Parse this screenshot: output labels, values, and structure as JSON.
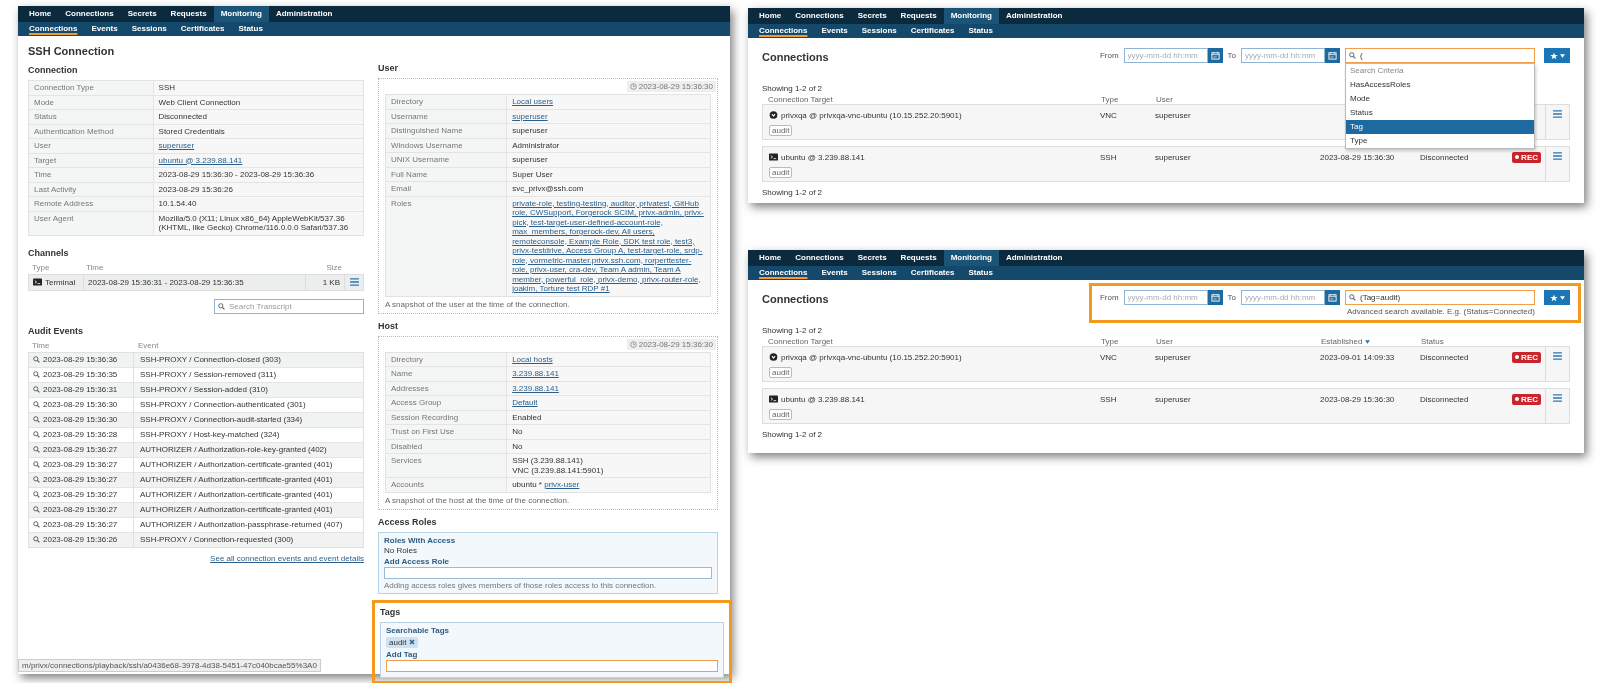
{
  "detail_view": {
    "nav": [
      {
        "label": "Home",
        "selected": false
      },
      {
        "label": "Connections",
        "selected": false
      },
      {
        "label": "Secrets",
        "selected": false
      },
      {
        "label": "Requests",
        "selected": false
      },
      {
        "label": "Monitoring",
        "selected": true
      },
      {
        "label": "Administration",
        "selected": false
      }
    ],
    "subnav": [
      {
        "label": "Connections",
        "selected": true
      },
      {
        "label": "Events",
        "selected": false
      },
      {
        "label": "Sessions",
        "selected": false
      },
      {
        "label": "Certificates",
        "selected": false
      },
      {
        "label": "Status",
        "selected": false
      }
    ],
    "title": "SSH Connection",
    "connection": {
      "heading": "Connection",
      "rows": [
        {
          "label": "Connection Type",
          "lines": [
            [
              {
                "text": "SSH",
                "link": false
              }
            ]
          ]
        },
        {
          "label": "Mode",
          "lines": [
            [
              {
                "text": "Web Client Connection",
                "link": false
              }
            ]
          ]
        },
        {
          "label": "Status",
          "lines": [
            [
              {
                "text": "Disconnected",
                "link": false
              }
            ]
          ]
        },
        {
          "label": "Authentication Method",
          "lines": [
            [
              {
                "text": "Stored Credentials",
                "link": false
              }
            ]
          ]
        },
        {
          "label": "User",
          "lines": [
            [
              {
                "text": "superuser",
                "link": true
              }
            ]
          ]
        },
        {
          "label": "Target",
          "lines": [
            [
              {
                "text": "ubuntu @ 3.239.88.141",
                "link": true
              }
            ]
          ]
        },
        {
          "label": "Time",
          "lines": [
            [
              {
                "text": "2023-08-29 15:36:30 - 2023-08-29 15:36:36",
                "link": false
              }
            ]
          ]
        },
        {
          "label": "Last Activity",
          "lines": [
            [
              {
                "text": "2023-08-29 15:36:26",
                "link": false
              }
            ]
          ]
        },
        {
          "label": "Remote Address",
          "lines": [
            [
              {
                "text": "10.1.54.40",
                "link": false
              }
            ]
          ]
        },
        {
          "label": "User Agent",
          "lines": [
            [
              {
                "text": "Mozilla/5.0 (X11; Linux x86_64) AppleWebKit/537.36 (KHTML, like Gecko) Chrome/116.0.0.0 Safari/537.36",
                "link": false
              }
            ]
          ]
        }
      ]
    },
    "channels": {
      "heading": "Channels",
      "columns": [
        "Type",
        "Time",
        "Size"
      ],
      "rows": [
        {
          "type": "Terminal",
          "time": "2023-08-29 15:36:31 - 2023-08-29 15:36:35",
          "size": "1 KB"
        }
      ],
      "search_placeholder": "Search Transcript"
    },
    "audit_events": {
      "heading": "Audit Events",
      "columns": [
        "Time",
        "Event"
      ],
      "rows": [
        {
          "time": "2023-08-29 15:36:36",
          "event": "SSH-PROXY / Connection-closed (303)"
        },
        {
          "time": "2023-08-29 15:36:35",
          "event": "SSH-PROXY / Session-removed (311)"
        },
        {
          "time": "2023-08-29 15:36:31",
          "event": "SSH-PROXY / Session-added (310)"
        },
        {
          "time": "2023-08-29 15:36:30",
          "event": "SSH-PROXY / Connection-authenticated (301)"
        },
        {
          "time": "2023-08-29 15:36:30",
          "event": "SSH-PROXY / Connection-audit-started (334)"
        },
        {
          "time": "2023-08-29 15:36:28",
          "event": "SSH-PROXY / Host-key-matched (324)"
        },
        {
          "time": "2023-08-29 15:36:27",
          "event": "AUTHORIZER / Authorization-role-key-granted (402)"
        },
        {
          "time": "2023-08-29 15:36:27",
          "event": "AUTHORIZER / Authorization-certificate-granted (401)"
        },
        {
          "time": "2023-08-29 15:36:27",
          "event": "AUTHORIZER / Authorization-certificate-granted (401)"
        },
        {
          "time": "2023-08-29 15:36:27",
          "event": "AUTHORIZER / Authorization-certificate-granted (401)"
        },
        {
          "time": "2023-08-29 15:36:27",
          "event": "AUTHORIZER / Authorization-certificate-granted (401)"
        },
        {
          "time": "2023-08-29 15:36:27",
          "event": "AUTHORIZER / Authorization-passphrase-returned (407)"
        },
        {
          "time": "2023-08-29 15:36:26",
          "event": "SSH-PROXY / Connection-requested (300)"
        }
      ],
      "link": "See all connection events and event details"
    },
    "user": {
      "heading": "User",
      "timestamp": "2023-08-29 15:36:30",
      "rows": [
        {
          "label": "Directory",
          "lines": [
            [
              {
                "text": "Local users",
                "link": true
              }
            ]
          ]
        },
        {
          "label": "Username",
          "lines": [
            [
              {
                "text": "superuser",
                "link": true
              }
            ]
          ]
        },
        {
          "label": "Distinguished Name",
          "lines": [
            [
              {
                "text": "superuser",
                "link": false
              }
            ]
          ]
        },
        {
          "label": "Windows Username",
          "lines": [
            [
              {
                "text": "Administrator",
                "link": false
              }
            ]
          ]
        },
        {
          "label": "UNIX Username",
          "lines": [
            [
              {
                "text": "superuser",
                "link": false
              }
            ]
          ]
        },
        {
          "label": "Full Name",
          "lines": [
            [
              {
                "text": "Super User",
                "link": false
              }
            ]
          ]
        },
        {
          "label": "Email",
          "lines": [
            [
              {
                "text": "svc_privx@ssh.com",
                "link": false
              }
            ]
          ]
        },
        {
          "label": "Roles",
          "lines": [
            [
              {
                "text": "private-role, testing-testing, auditor, privatest, GitHub role, CWSupport, Forgerock SCIM, privx-admin, privx-pick, test-target-user-defined-account-role, max_members, forgerock-dev, All users, remoteconsole, Example Role, SDK test role, test3, privx-testdrive, Access Group A, test-target-role, srdp-role, vormetric-master.privx.ssh.com, rorperttester-role, privx-user, cra-dev, Team A admin, Team A member, powerful_role, privx-demo, privx-router-role, joakim, Torture test RDP #1",
                "link": true
              }
            ]
          ]
        }
      ],
      "caption": "A snapshot of the user at the time of the connection."
    },
    "host": {
      "heading": "Host",
      "timestamp": "2023-08-29 15:36:30",
      "rows": [
        {
          "label": "Directory",
          "lines": [
            [
              {
                "text": "Local hosts",
                "link": true
              }
            ]
          ]
        },
        {
          "label": "Name",
          "lines": [
            [
              {
                "text": "3.239.88.141",
                "link": true
              }
            ]
          ]
        },
        {
          "label": "Addresses",
          "lines": [
            [
              {
                "text": "3.239.88.141",
                "link": true
              }
            ]
          ]
        },
        {
          "label": "Access Group",
          "lines": [
            [
              {
                "text": "Default",
                "link": true
              }
            ]
          ]
        },
        {
          "label": "Session Recording",
          "lines": [
            [
              {
                "text": "Enabled",
                "link": false
              }
            ]
          ]
        },
        {
          "label": "Trust on First Use",
          "lines": [
            [
              {
                "text": "No",
                "link": false
              }
            ]
          ]
        },
        {
          "label": "Disabled",
          "lines": [
            [
              {
                "text": "No",
                "link": false
              }
            ]
          ]
        },
        {
          "label": "Services",
          "lines": [
            [
              {
                "text": "SSH (3.239.88.141)",
                "link": false
              }
            ],
            [
              {
                "text": "VNC (3.239.88.141:5901)",
                "link": false
              }
            ]
          ]
        },
        {
          "label": "Accounts",
          "lines": [
            [
              {
                "text": "ubuntu *",
                "link": false
              },
              {
                "text": "privx-user",
                "link": true
              }
            ]
          ]
        }
      ],
      "caption": "A snapshot of the host at the time of the connection."
    },
    "access_roles": {
      "heading": "Access Roles",
      "label": "Roles With Access",
      "value": "No Roles",
      "field_label": "Add Access Role",
      "focused": false,
      "hint": "Adding access roles gives members of those roles access to this connection."
    },
    "tags": {
      "heading": "Tags",
      "highlighted": true,
      "label": "Searchable Tags",
      "chips": [
        "audit"
      ],
      "field_label": "Add Tag",
      "focused": true
    },
    "status_url": "m/privx/connections/playback/ssh/a0436e68-3978-4d38-5451-47c040bcae55%3A0"
  },
  "criteria_view": {
    "nav": [
      {
        "label": "Home",
        "selected": false
      },
      {
        "label": "Connections",
        "selected": false
      },
      {
        "label": "Secrets",
        "selected": false
      },
      {
        "label": "Requests",
        "selected": false
      },
      {
        "label": "Monitoring",
        "selected": true
      },
      {
        "label": "Administration",
        "selected": false
      }
    ],
    "subnav": [
      {
        "label": "Connections",
        "selected": true
      },
      {
        "label": "Events",
        "selected": false
      },
      {
        "label": "Sessions",
        "selected": false
      },
      {
        "label": "Certificates",
        "selected": false
      },
      {
        "label": "Status",
        "selected": false
      }
    ],
    "title": "Connections",
    "filters": {
      "highlighted": false,
      "from_label": "From",
      "from_placeholder": "yyyy-mm-dd hh:mm",
      "to_label": "To",
      "to_placeholder": "yyyy-mm-dd hh:mm",
      "search_value": "(",
      "focused": true,
      "dropdown": [
        {
          "kind": "header",
          "label": "Search Criteria"
        },
        {
          "kind": "option",
          "label": "HasAccessRoles",
          "selected": false
        },
        {
          "kind": "option",
          "label": "Mode",
          "selected": false
        },
        {
          "kind": "option",
          "label": "Status",
          "selected": false
        },
        {
          "kind": "option",
          "label": "Tag",
          "selected": true
        },
        {
          "kind": "option",
          "label": "Type",
          "selected": false
        }
      ]
    },
    "showing_top": "Showing 1-2 of 2",
    "columns": [
      {
        "label": "Connection Target",
        "sorted": false
      },
      {
        "label": "Type",
        "sorted": false
      },
      {
        "label": "User",
        "sorted": false
      }
    ],
    "rows": [
      {
        "kind": "vnc",
        "target": "privxqa @ privxqa-vnc-ubuntu (10.15.252.20:5901)",
        "type": "VNC",
        "user": "superuser",
        "tags": [
          "audit"
        ]
      },
      {
        "kind": "ssh",
        "target": "ubuntu @ 3.239.88.141",
        "type": "SSH",
        "user": "superuser",
        "established": "2023-08-29 15:36:30",
        "status": "Disconnected",
        "rec": "REC",
        "tags": [
          "audit"
        ]
      }
    ],
    "showing_bottom": "Showing 1-2 of 2"
  },
  "filtered_view": {
    "nav": [
      {
        "label": "Home",
        "selected": false
      },
      {
        "label": "Connections",
        "selected": false
      },
      {
        "label": "Secrets",
        "selected": false
      },
      {
        "label": "Requests",
        "selected": false
      },
      {
        "label": "Monitoring",
        "selected": true
      },
      {
        "label": "Administration",
        "selected": false
      }
    ],
    "subnav": [
      {
        "label": "Connections",
        "selected": true
      },
      {
        "label": "Events",
        "selected": false
      },
      {
        "label": "Sessions",
        "selected": false
      },
      {
        "label": "Certificates",
        "selected": false
      },
      {
        "label": "Status",
        "selected": false
      }
    ],
    "title": "Connections",
    "filters": {
      "highlighted": true,
      "from_label": "From",
      "from_placeholder": "yyyy-mm-dd hh:mm",
      "to_label": "To",
      "to_placeholder": "yyyy-mm-dd hh:mm",
      "search_value": "(Tag=audit)",
      "focused": true,
      "hint": "Advanced search available. E.g. (Status=Connected)"
    },
    "showing_top": "Showing 1-2 of 2",
    "columns": [
      {
        "label": "Connection Target",
        "sorted": false
      },
      {
        "label": "Type",
        "sorted": false
      },
      {
        "label": "User",
        "sorted": false
      },
      {
        "label": "Established",
        "sorted": true
      },
      {
        "label": "Status",
        "sorted": false
      }
    ],
    "rows": [
      {
        "kind": "vnc",
        "target": "privxqa @ privxqa-vnc-ubuntu (10.15.252.20:5901)",
        "type": "VNC",
        "user": "superuser",
        "established": "2023-09-01 14:09:33",
        "status": "Disconnected",
        "rec": "REC",
        "tags": [
          "audit"
        ]
      },
      {
        "kind": "ssh",
        "target": "ubuntu @ 3.239.88.141",
        "type": "SSH",
        "user": "superuser",
        "established": "2023-08-29 15:36:30",
        "status": "Disconnected",
        "rec": "REC",
        "tags": [
          "audit"
        ]
      }
    ],
    "showing_bottom": "Showing 1-2 of 2"
  }
}
